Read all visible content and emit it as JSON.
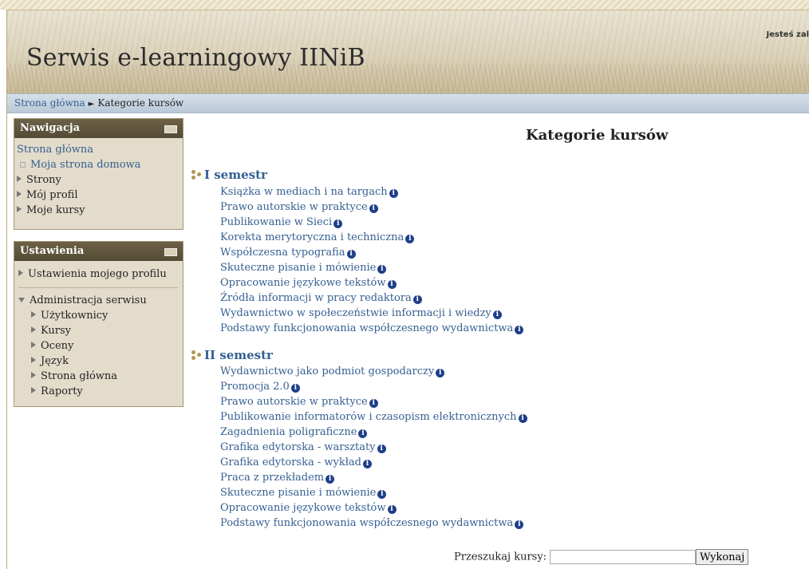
{
  "header": {
    "site_title": "Serwis e-learningowy IINiB",
    "login_info": "Jesteś zal"
  },
  "breadcrumb": {
    "home": "Strona główna",
    "separator": "►",
    "current": "Kategorie kursów"
  },
  "nav_block": {
    "title": "Nawigacja",
    "home": "Strona główna",
    "items": [
      {
        "label": "Moja strona domowa",
        "type": "bullet"
      },
      {
        "label": "Strony",
        "type": "arrow"
      },
      {
        "label": "Mój profil",
        "type": "arrow"
      },
      {
        "label": "Moje kursy",
        "type": "arrow"
      }
    ]
  },
  "settings_block": {
    "title": "Ustawienia",
    "profile_settings": "Ustawienia mojego profilu",
    "admin": "Administracja serwisu",
    "admin_items": [
      "Użytkownicy",
      "Kursy",
      "Oceny",
      "Język",
      "Strona główna",
      "Raporty"
    ]
  },
  "main": {
    "title": "Kategorie kursów",
    "categories": [
      {
        "name": "I semestr",
        "courses": [
          "Książka w mediach i na targach",
          "Prawo autorskie w praktyce",
          "Publikowanie w Sieci",
          "Korekta merytoryczna i techniczna",
          "Współczesna typografia",
          "Skuteczne pisanie i mówienie",
          "Opracowanie językowe tekstów",
          "Źródła informacji w pracy redaktora",
          "Wydawnictwo w społeczeństwie informacji i wiedzy",
          "Podstawy funkcjonowania współczesnego wydawnictwa"
        ]
      },
      {
        "name": "II semestr",
        "courses": [
          "Wydawnictwo jako podmiot gospodarczy",
          "Promocja 2.0",
          "Prawo autorskie w praktyce",
          "Publikowanie informatorów i czasopism elektronicznych",
          "Zagadnienia poligraficzne",
          "Grafika edytorska - warsztaty",
          "Grafika edytorska - wykład",
          "Praca z przekładem",
          "Skuteczne pisanie i mówienie",
          "Opracowanie językowe tekstów",
          "Podstawy funkcjonowania współczesnego wydawnictwa"
        ]
      }
    ],
    "info_icon": "i"
  },
  "search": {
    "label": "Przeszukaj kursy:",
    "value": "",
    "button": "Wykonaj"
  },
  "colors": {
    "link": "#355f91",
    "block_header": "#5f553d",
    "block_bg": "#e3dccb",
    "navbar": "#c4d1de",
    "info_icon": "#1f3f8a"
  }
}
